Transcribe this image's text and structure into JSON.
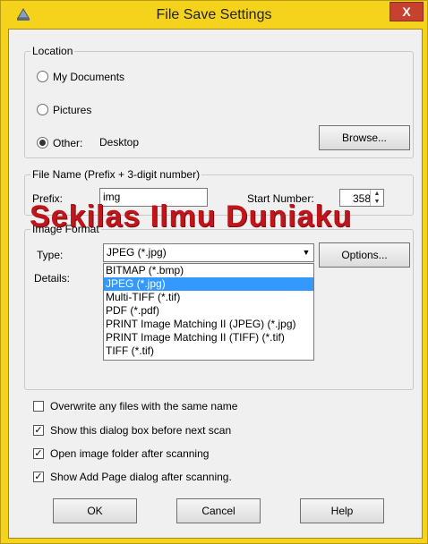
{
  "window": {
    "title": "File Save Settings",
    "close_symbol": "X"
  },
  "location": {
    "legend": "Location",
    "options": [
      "My Documents",
      "Pictures",
      "Other:"
    ],
    "selected": "Other:",
    "other_value": "Desktop",
    "browse_label": "Browse..."
  },
  "filename": {
    "legend": "File Name (Prefix + 3-digit number)",
    "prefix_label": "Prefix:",
    "prefix_value": "img",
    "start_label": "Start Number:",
    "start_value": "358"
  },
  "watermark": "Sekilas Ilmu Duniaku",
  "image_format": {
    "legend": "Image Format",
    "type_label": "Type:",
    "type_value": "JPEG (*.jpg)",
    "options_label": "Options...",
    "details_label": "Details:",
    "dropdown_items": [
      "BITMAP (*.bmp)",
      "JPEG (*.jpg)",
      "Multi-TIFF (*.tif)",
      "PDF (*.pdf)",
      "PRINT Image Matching II (JPEG) (*.jpg)",
      "PRINT Image Matching II (TIFF) (*.tif)",
      "TIFF (*.tif)"
    ],
    "highlighted": "JPEG (*.jpg)"
  },
  "checkboxes": [
    {
      "label": "Overwrite any files with the same name",
      "checked": false
    },
    {
      "label": "Show this dialog box before next scan",
      "checked": true
    },
    {
      "label": "Open image folder after scanning",
      "checked": true
    },
    {
      "label": "Show Add Page dialog after scanning.",
      "checked": true
    }
  ],
  "buttons": {
    "ok": "OK",
    "cancel": "Cancel",
    "help": "Help"
  },
  "check_mark": "✓"
}
